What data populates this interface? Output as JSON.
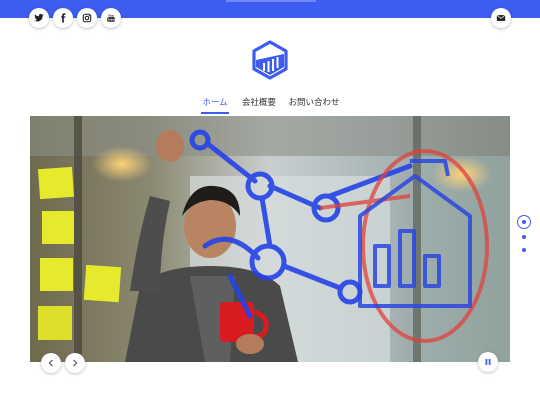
{
  "header": {
    "social": [
      {
        "name": "twitter-icon"
      },
      {
        "name": "facebook-icon"
      },
      {
        "name": "instagram-icon"
      },
      {
        "name": "youtube-icon"
      }
    ],
    "mail_icon": "mail-icon",
    "accent_color": "#3d5cf0"
  },
  "logo": {
    "icon": "chart-hexagon-logo"
  },
  "nav": {
    "items": [
      {
        "label": "ホーム",
        "active": true
      },
      {
        "label": "会社概要",
        "active": false
      },
      {
        "label": "お問い合わせ",
        "active": false
      }
    ]
  },
  "slider": {
    "image": "person-drawing-diagram-on-glass",
    "prev_icon": "chevron-left-icon",
    "next_icon": "chevron-right-icon",
    "pause_icon": "pause-icon",
    "slide_count": 3,
    "current_slide": 1
  }
}
